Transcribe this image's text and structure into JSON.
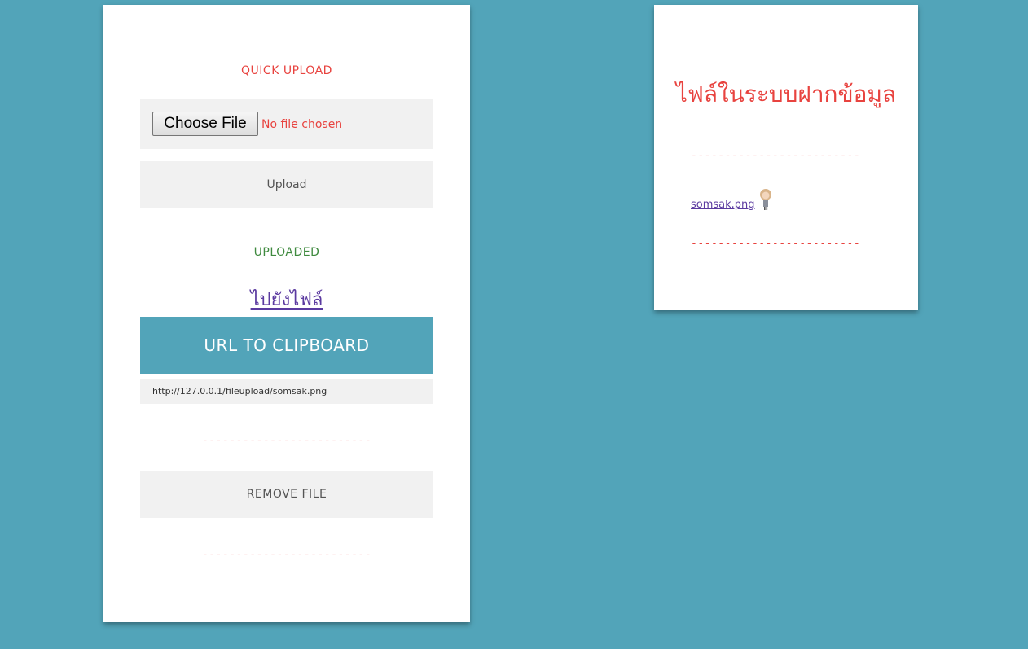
{
  "upload_panel": {
    "title": "QUICK UPLOAD",
    "choose_file_label": "Choose File",
    "no_file_text": "No file chosen",
    "upload_label": "Upload",
    "uploaded_title": "UPLOADED",
    "goto_file_link": "ไปยังไฟล์",
    "clipboard_label": "URL TO CLIPBOARD",
    "file_url": "http://127.0.0.1/fileupload/somsak.png",
    "divider_text": "-------------------------",
    "remove_label": "REMOVE FILE"
  },
  "files_panel": {
    "title": "ไฟล์ในระบบฝากข้อมูล",
    "divider_text": "-------------------------",
    "files": [
      {
        "name": "somsak.png",
        "thumb_icon": "image-thumbnail-icon"
      }
    ]
  },
  "colors": {
    "background": "#52a4b9",
    "accent_red": "#e8433f",
    "accent_green": "#3f8a3f",
    "link_purple": "#5b3aa0",
    "button_grey": "#f1f1f1"
  }
}
